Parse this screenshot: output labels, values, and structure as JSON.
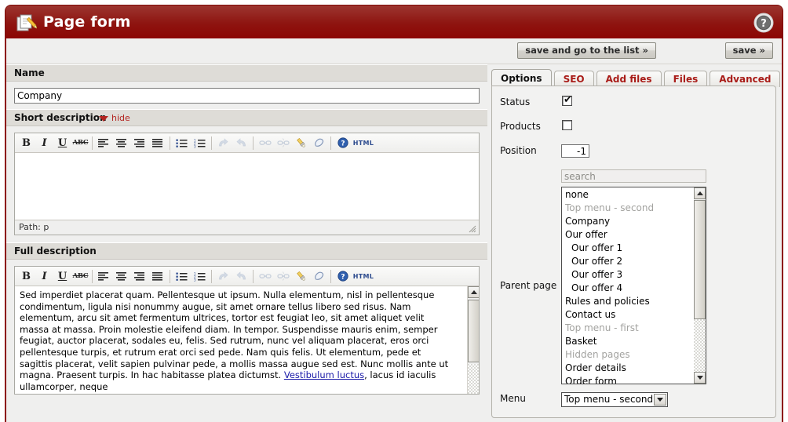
{
  "window": {
    "title": "Page form",
    "title_icon": "page-edit-icon",
    "help_icon": "help-question-icon",
    "header_color_top": "#9c3630",
    "header_color_bottom": "#8c0603",
    "accent_red": "#a91c18"
  },
  "toolbar": {
    "save_and_list_label": "save and go to the list »",
    "save_label": "save »"
  },
  "left": {
    "name_section": {
      "label": "Name",
      "value": "Company",
      "placeholder": ""
    },
    "short_description": {
      "label": "Short description",
      "hide_label": "hide",
      "content": "",
      "status": "Path: p"
    },
    "full_description": {
      "label": "Full description",
      "paragraph_1": "Sed imperdiet placerat quam. Pellentesque ut ipsum. Nulla elementum, nisl in pellentesque condimentum, ligula nisi nonummy augue, sit amet ornare tellus libero sed risus. Nam elementum, arcu sit amet fermentum ultrices, tortor est feugiat leo, sit amet aliquet velit massa at massa. Proin molestie eleifend diam. In tempor. Suspendisse mauris enim, semper feugiat, auctor placerat, sodales eu, felis. Sed rutrum, nunc vel aliquam placerat, eros orci pellentesque turpis, et rutrum erat orci sed pede. Nam quis felis. Ut elementum, pede et sagittis placerat, velit sapien pulvinar pede, a mollis massa augue sed est. Nunc mollis ante ut magna. Praesent turpis. In hac habitasse platea dictumst. ",
      "link_text": "Vestibulum luctus",
      "paragraph_2": ", lacus id iaculis ullamcorper, neque"
    }
  },
  "editor_toolbar": {
    "buttons": [
      {
        "name": "bold-icon",
        "glyph": "B",
        "style": "bold",
        "dim": false
      },
      {
        "name": "italic-icon",
        "glyph": "I",
        "style": "italic",
        "dim": false
      },
      {
        "name": "underline-icon",
        "glyph": "U",
        "style": "underline",
        "dim": false
      },
      {
        "name": "strikethrough-icon",
        "glyph": "ABC",
        "style": "strike",
        "dim": false
      },
      {
        "name": "separator",
        "glyph": "",
        "style": "sep",
        "dim": false
      },
      {
        "name": "align-left-icon",
        "glyph": "",
        "style": "align-left",
        "dim": false
      },
      {
        "name": "align-center-icon",
        "glyph": "",
        "style": "align-center",
        "dim": false
      },
      {
        "name": "align-right-icon",
        "glyph": "",
        "style": "align-right",
        "dim": false
      },
      {
        "name": "align-justify-icon",
        "glyph": "",
        "style": "align-justify",
        "dim": false
      },
      {
        "name": "separator",
        "glyph": "",
        "style": "sep",
        "dim": false
      },
      {
        "name": "bullet-list-icon",
        "glyph": "",
        "style": "ul",
        "dim": false
      },
      {
        "name": "numbered-list-icon",
        "glyph": "",
        "style": "ol",
        "dim": false
      },
      {
        "name": "separator",
        "glyph": "",
        "style": "sep",
        "dim": false
      },
      {
        "name": "undo-icon",
        "glyph": "↶",
        "style": "arrow",
        "dim": true
      },
      {
        "name": "redo-icon",
        "glyph": "↷",
        "style": "arrow",
        "dim": true
      },
      {
        "name": "separator",
        "glyph": "",
        "style": "sep",
        "dim": false
      },
      {
        "name": "insert-link-icon",
        "glyph": "🔗",
        "style": "emoji",
        "dim": true
      },
      {
        "name": "unlink-icon",
        "glyph": "💥",
        "style": "emoji",
        "dim": true
      },
      {
        "name": "cleanup-icon",
        "glyph": "🖌",
        "style": "emoji",
        "dim": false
      },
      {
        "name": "remove-format-icon",
        "glyph": "🧽",
        "style": "emoji",
        "dim": false
      },
      {
        "name": "separator",
        "glyph": "",
        "style": "sep",
        "dim": false
      },
      {
        "name": "help-icon",
        "glyph": "?",
        "style": "help",
        "dim": false
      },
      {
        "name": "html-source-icon",
        "glyph": "HTML",
        "style": "html",
        "dim": false
      }
    ]
  },
  "right": {
    "tabs": [
      {
        "label": "Options",
        "active": true
      },
      {
        "label": "SEO",
        "active": false
      },
      {
        "label": "Add files",
        "active": false
      },
      {
        "label": "Files",
        "active": false
      },
      {
        "label": "Advanced",
        "active": false
      }
    ],
    "status": {
      "label": "Status",
      "checked": true,
      "tick": "✔"
    },
    "products": {
      "label": "Products",
      "checked": false,
      "tick": ""
    },
    "position": {
      "label": "Position",
      "value": "-1"
    },
    "parent_page": {
      "label": "Parent page",
      "search_placeholder": "search",
      "search_value": "",
      "options": [
        {
          "label": "none",
          "muted": false,
          "indent": false
        },
        {
          "label": "Top menu - second",
          "muted": true,
          "indent": false
        },
        {
          "label": "Company",
          "muted": false,
          "indent": false
        },
        {
          "label": "Our offer",
          "muted": false,
          "indent": false
        },
        {
          "label": "Our offer 1",
          "muted": false,
          "indent": true
        },
        {
          "label": "Our offer 2",
          "muted": false,
          "indent": true
        },
        {
          "label": "Our offer 3",
          "muted": false,
          "indent": true
        },
        {
          "label": "Our offer 4",
          "muted": false,
          "indent": true
        },
        {
          "label": "Rules and policies",
          "muted": false,
          "indent": false
        },
        {
          "label": "Contact us",
          "muted": false,
          "indent": false
        },
        {
          "label": "Top menu - first",
          "muted": true,
          "indent": false
        },
        {
          "label": "Basket",
          "muted": false,
          "indent": false
        },
        {
          "label": "Hidden pages",
          "muted": true,
          "indent": false
        },
        {
          "label": "Order details",
          "muted": false,
          "indent": false
        },
        {
          "label": "Order form",
          "muted": false,
          "indent": false
        }
      ]
    },
    "menu": {
      "label": "Menu",
      "selected": "Top menu - second"
    }
  }
}
